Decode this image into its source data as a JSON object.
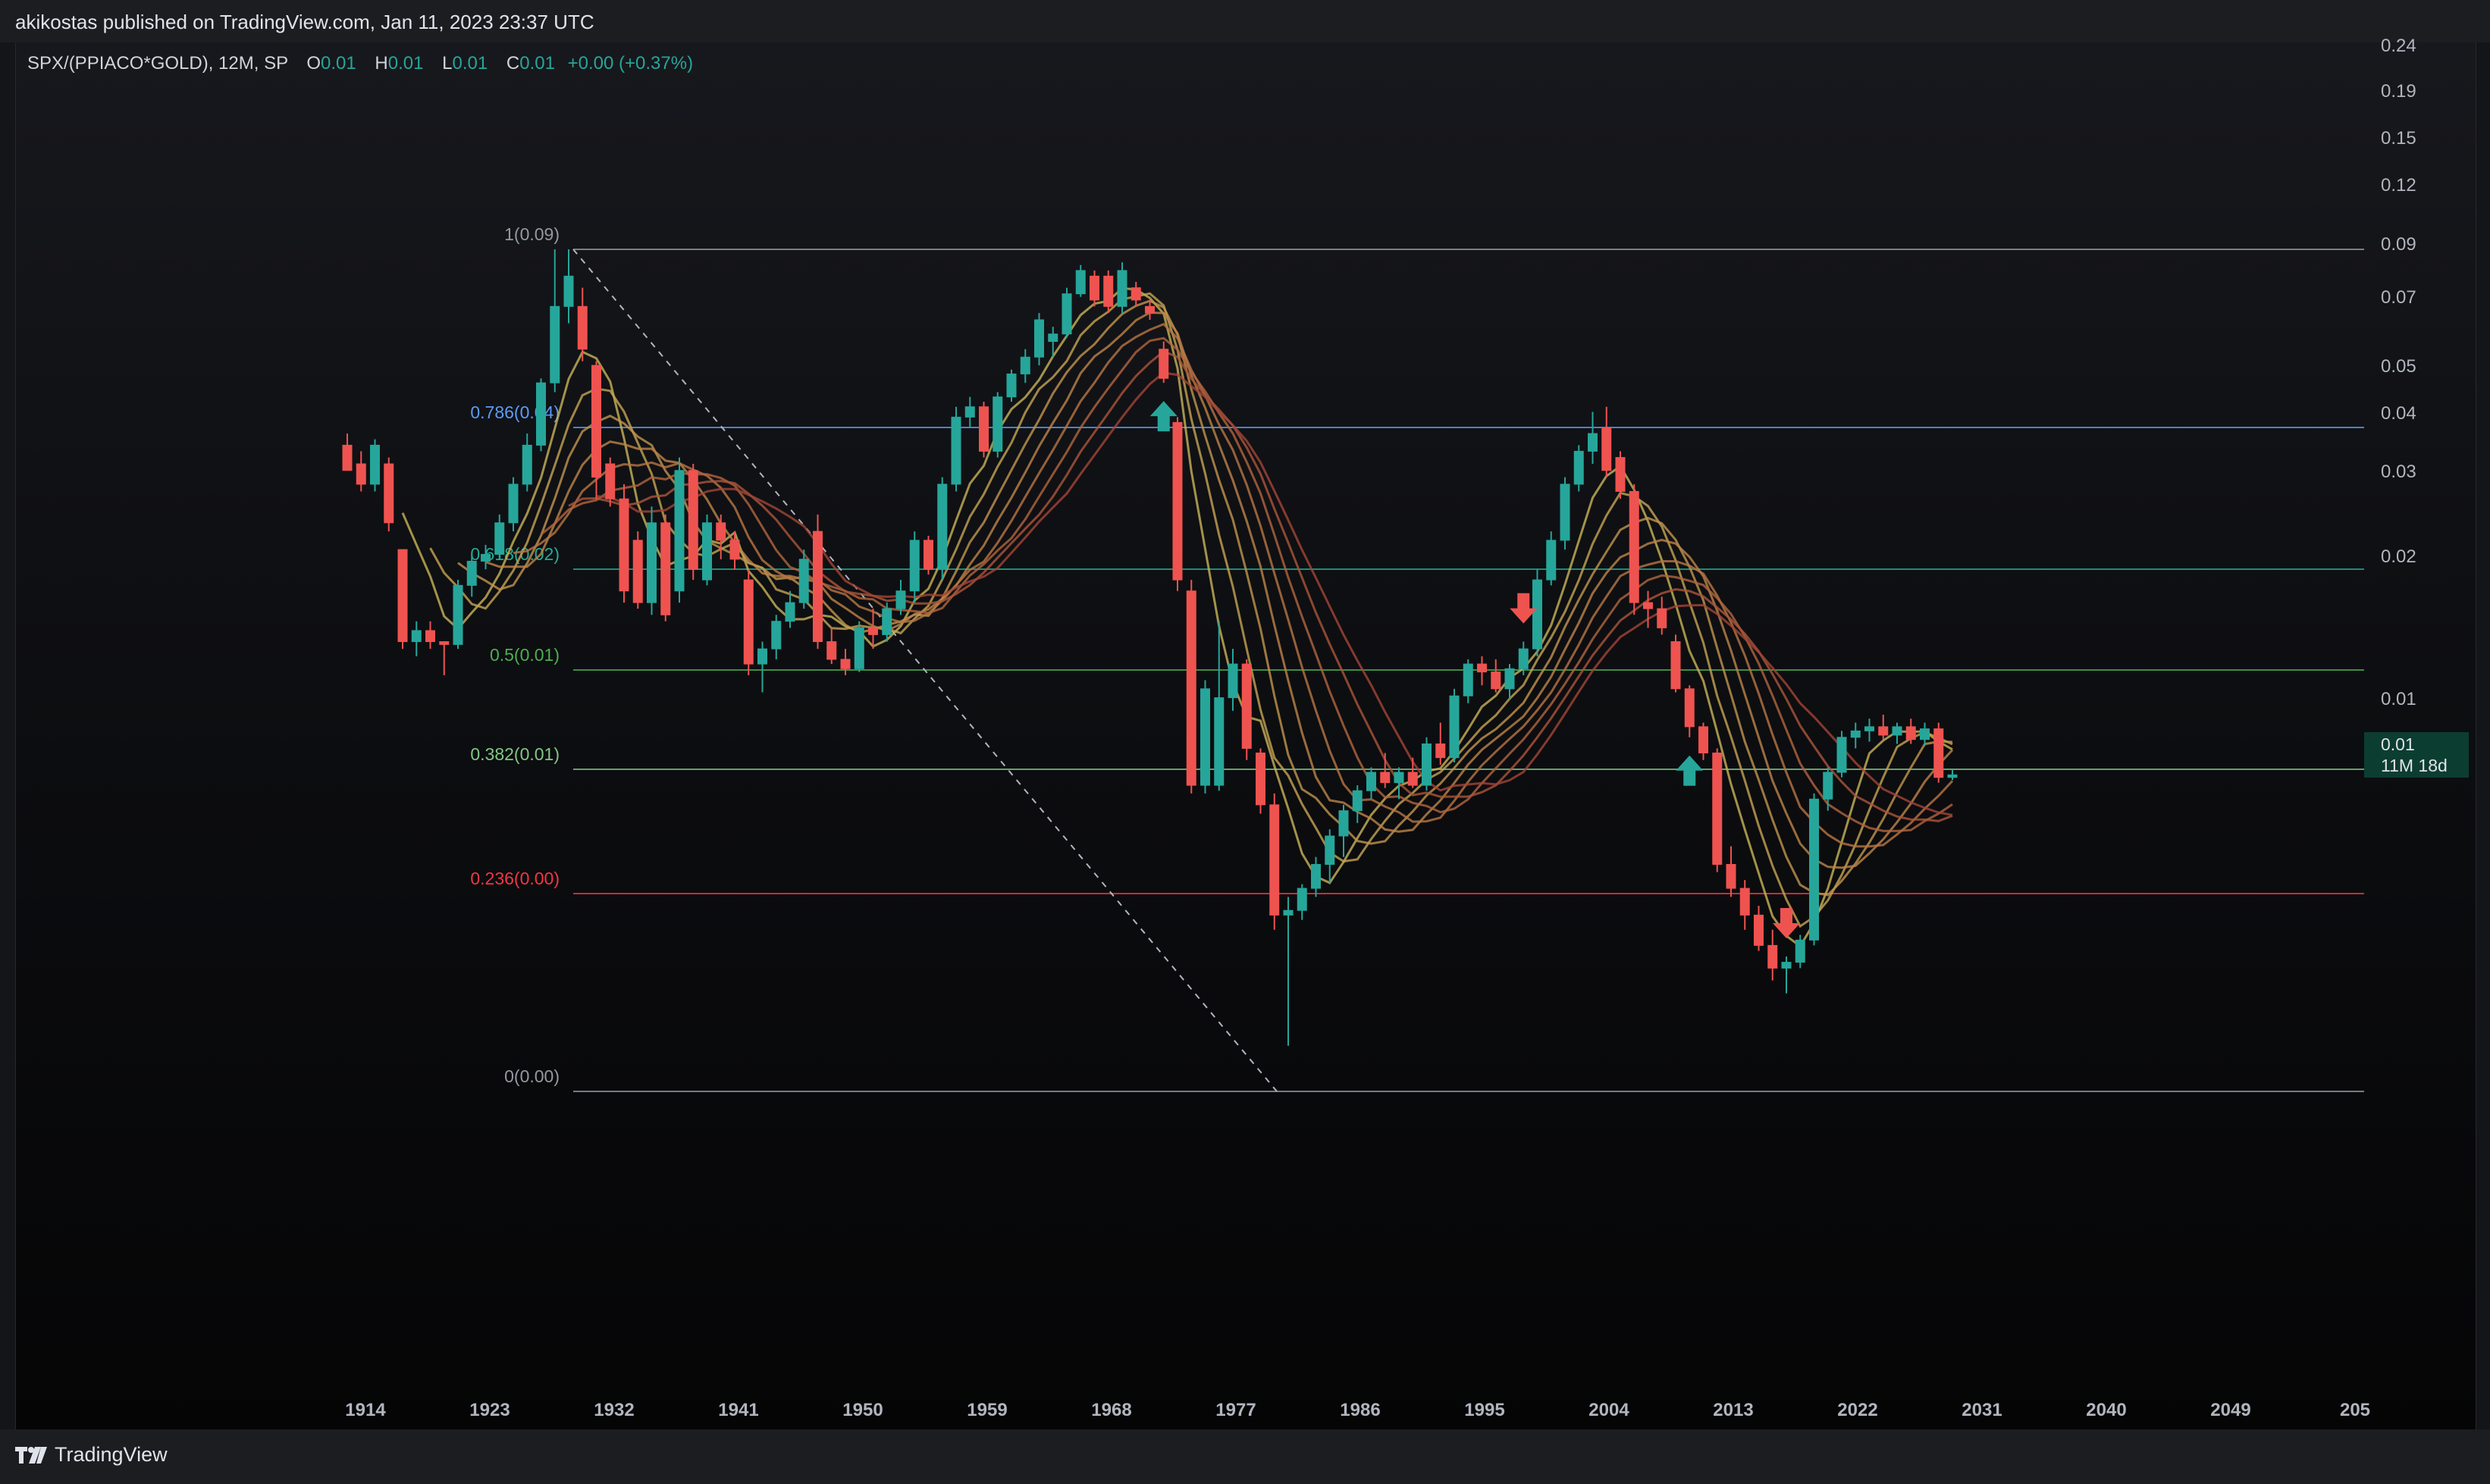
{
  "header": {
    "publisher": "akikostas published on TradingView.com, Jan 11, 2023 23:37 UTC"
  },
  "legend": {
    "symbol": "SPX/(PPIACO*GOLD), 12M, SP",
    "open_label": "O",
    "open": "0.01",
    "high_label": "H",
    "high": "0.01",
    "low_label": "L",
    "low": "0.01",
    "close_label": "C",
    "close": "0.01",
    "change": "+0.00 (+0.37%)"
  },
  "footer": {
    "brand": "TradingView"
  },
  "colors": {
    "up": "#26a69a",
    "down": "#ef5350",
    "fib_1": "#9598a1",
    "fib_0786": "#5b9cf6",
    "fib_0618": "#22ab94",
    "fib_05": "#4caf50",
    "fib_0382": "#81c784",
    "fib_0236": "#f23645",
    "fib_0": "#9598a1",
    "price_tag": "#0c3d31"
  },
  "chart_data": {
    "type": "candlestick",
    "interval": "12M",
    "y_scale": "log",
    "x_ticks": [
      "1914",
      "1923",
      "1932",
      "1941",
      "1950",
      "1959",
      "1968",
      "1977",
      "1986",
      "1995",
      "2004",
      "2013",
      "2022",
      "2031",
      "2040",
      "2049",
      "205"
    ],
    "y_ticks": [
      "0.24",
      "0.19",
      "0.15",
      "0.12",
      "0.09",
      "0.07",
      "0.05",
      "0.04",
      "0.03",
      "0.02",
      "0.01"
    ],
    "current_price": {
      "value": "0.01",
      "countdown": "11M 18d"
    },
    "fib_levels": [
      {
        "label": "1(0.09)",
        "level": 1,
        "value": 0.09
      },
      {
        "label": "0.786(0.04)",
        "level": 0.786,
        "value": 0.04
      },
      {
        "label": "0.618(0.02)",
        "level": 0.618,
        "value": 0.02
      },
      {
        "label": "0.5(0.01)",
        "level": 0.5,
        "value": 0.01
      },
      {
        "label": "0.382(0.01)",
        "level": 0.382,
        "value": 0.01
      },
      {
        "label": "0.236(0.00)",
        "level": 0.236,
        "value": 0.0
      },
      {
        "label": "0(0.00)",
        "level": 0,
        "value": 0.0
      }
    ],
    "trend_line": {
      "from": {
        "year": 1929,
        "value": 0.09
      },
      "to": {
        "year": 1980,
        "value": 0.0027
      }
    },
    "arrows": [
      {
        "year": 1973,
        "direction": "up"
      },
      {
        "year": 1999,
        "direction": "down"
      },
      {
        "year": 2011,
        "direction": "up"
      },
      {
        "year": 2018,
        "direction": "down"
      }
    ],
    "candles": [
      {
        "year": 1914,
        "o": 0.038,
        "h": 0.04,
        "l": 0.034,
        "c": 0.034
      },
      {
        "year": 1915,
        "o": 0.035,
        "h": 0.037,
        "l": 0.031,
        "c": 0.032
      },
      {
        "year": 1916,
        "o": 0.032,
        "h": 0.039,
        "l": 0.031,
        "c": 0.038
      },
      {
        "year": 1917,
        "o": 0.035,
        "h": 0.036,
        "l": 0.026,
        "c": 0.027
      },
      {
        "year": 1918,
        "o": 0.024,
        "h": 0.024,
        "l": 0.0155,
        "c": 0.016
      },
      {
        "year": 1919,
        "o": 0.016,
        "h": 0.0175,
        "l": 0.015,
        "c": 0.0168
      },
      {
        "year": 1920,
        "o": 0.0168,
        "h": 0.0175,
        "l": 0.0155,
        "c": 0.016
      },
      {
        "year": 1921,
        "o": 0.016,
        "h": 0.016,
        "l": 0.0138,
        "c": 0.0158
      },
      {
        "year": 1922,
        "o": 0.0158,
        "h": 0.021,
        "l": 0.0155,
        "c": 0.0205
      },
      {
        "year": 1923,
        "o": 0.0205,
        "h": 0.0235,
        "l": 0.0195,
        "c": 0.0228
      },
      {
        "year": 1924,
        "o": 0.0228,
        "h": 0.0245,
        "l": 0.022,
        "c": 0.0235
      },
      {
        "year": 1925,
        "o": 0.0235,
        "h": 0.028,
        "l": 0.023,
        "c": 0.027
      },
      {
        "year": 1926,
        "o": 0.027,
        "h": 0.033,
        "l": 0.026,
        "c": 0.032
      },
      {
        "year": 1927,
        "o": 0.032,
        "h": 0.04,
        "l": 0.031,
        "c": 0.038
      },
      {
        "year": 1928,
        "o": 0.038,
        "h": 0.051,
        "l": 0.037,
        "c": 0.05
      },
      {
        "year": 1929,
        "o": 0.05,
        "h": 0.09,
        "l": 0.048,
        "c": 0.07
      },
      {
        "year": 1930,
        "o": 0.07,
        "h": 0.09,
        "l": 0.065,
        "c": 0.08
      },
      {
        "year": 1931,
        "o": 0.07,
        "h": 0.076,
        "l": 0.055,
        "c": 0.058
      },
      {
        "year": 1932,
        "o": 0.054,
        "h": 0.055,
        "l": 0.03,
        "c": 0.033
      },
      {
        "year": 1933,
        "o": 0.035,
        "h": 0.036,
        "l": 0.029,
        "c": 0.03
      },
      {
        "year": 1934,
        "o": 0.03,
        "h": 0.032,
        "l": 0.019,
        "c": 0.02
      },
      {
        "year": 1935,
        "o": 0.025,
        "h": 0.026,
        "l": 0.0185,
        "c": 0.019
      },
      {
        "year": 1936,
        "o": 0.019,
        "h": 0.029,
        "l": 0.018,
        "c": 0.027
      },
      {
        "year": 1937,
        "o": 0.027,
        "h": 0.028,
        "l": 0.0175,
        "c": 0.018
      },
      {
        "year": 1938,
        "o": 0.02,
        "h": 0.036,
        "l": 0.019,
        "c": 0.034
      },
      {
        "year": 1939,
        "o": 0.034,
        "h": 0.035,
        "l": 0.021,
        "c": 0.022
      },
      {
        "year": 1940,
        "o": 0.021,
        "h": 0.028,
        "l": 0.0205,
        "c": 0.027
      },
      {
        "year": 1941,
        "o": 0.027,
        "h": 0.028,
        "l": 0.023,
        "c": 0.025
      },
      {
        "year": 1942,
        "o": 0.025,
        "h": 0.026,
        "l": 0.022,
        "c": 0.023
      },
      {
        "year": 1943,
        "o": 0.021,
        "h": 0.022,
        "l": 0.0138,
        "c": 0.0145
      },
      {
        "year": 1944,
        "o": 0.0145,
        "h": 0.016,
        "l": 0.0128,
        "c": 0.0155
      },
      {
        "year": 1945,
        "o": 0.0155,
        "h": 0.018,
        "l": 0.0148,
        "c": 0.0175
      },
      {
        "year": 1946,
        "o": 0.0175,
        "h": 0.02,
        "l": 0.017,
        "c": 0.019
      },
      {
        "year": 1947,
        "o": 0.019,
        "h": 0.024,
        "l": 0.0185,
        "c": 0.023
      },
      {
        "year": 1948,
        "o": 0.026,
        "h": 0.028,
        "l": 0.0155,
        "c": 0.016
      },
      {
        "year": 1949,
        "o": 0.016,
        "h": 0.017,
        "l": 0.0145,
        "c": 0.0148
      },
      {
        "year": 1950,
        "o": 0.0148,
        "h": 0.0155,
        "l": 0.0138,
        "c": 0.0142
      },
      {
        "year": 1951,
        "o": 0.0142,
        "h": 0.0175,
        "l": 0.014,
        "c": 0.017
      },
      {
        "year": 1952,
        "o": 0.017,
        "h": 0.0185,
        "l": 0.0155,
        "c": 0.0165
      },
      {
        "year": 1953,
        "o": 0.0165,
        "h": 0.019,
        "l": 0.016,
        "c": 0.0185
      },
      {
        "year": 1954,
        "o": 0.0185,
        "h": 0.021,
        "l": 0.018,
        "c": 0.02
      },
      {
        "year": 1955,
        "o": 0.02,
        "h": 0.026,
        "l": 0.019,
        "c": 0.025
      },
      {
        "year": 1956,
        "o": 0.025,
        "h": 0.0255,
        "l": 0.0215,
        "c": 0.022
      },
      {
        "year": 1957,
        "o": 0.022,
        "h": 0.033,
        "l": 0.021,
        "c": 0.032
      },
      {
        "year": 1958,
        "o": 0.032,
        "h": 0.045,
        "l": 0.031,
        "c": 0.043
      },
      {
        "year": 1959,
        "o": 0.043,
        "h": 0.047,
        "l": 0.041,
        "c": 0.045
      },
      {
        "year": 1960,
        "o": 0.045,
        "h": 0.046,
        "l": 0.036,
        "c": 0.037
      },
      {
        "year": 1961,
        "o": 0.037,
        "h": 0.048,
        "l": 0.036,
        "c": 0.047
      },
      {
        "year": 1962,
        "o": 0.047,
        "h": 0.053,
        "l": 0.046,
        "c": 0.052
      },
      {
        "year": 1963,
        "o": 0.052,
        "h": 0.058,
        "l": 0.05,
        "c": 0.056
      },
      {
        "year": 1964,
        "o": 0.056,
        "h": 0.068,
        "l": 0.054,
        "c": 0.066
      },
      {
        "year": 1965,
        "o": 0.06,
        "h": 0.064,
        "l": 0.056,
        "c": 0.062
      },
      {
        "year": 1966,
        "o": 0.062,
        "h": 0.076,
        "l": 0.061,
        "c": 0.074
      },
      {
        "year": 1967,
        "o": 0.074,
        "h": 0.084,
        "l": 0.073,
        "c": 0.082
      },
      {
        "year": 1968,
        "o": 0.08,
        "h": 0.082,
        "l": 0.07,
        "c": 0.072
      },
      {
        "year": 1969,
        "o": 0.08,
        "h": 0.082,
        "l": 0.068,
        "c": 0.07
      },
      {
        "year": 1970,
        "o": 0.07,
        "h": 0.085,
        "l": 0.068,
        "c": 0.082
      },
      {
        "year": 1971,
        "o": 0.076,
        "h": 0.078,
        "l": 0.07,
        "c": 0.072
      },
      {
        "year": 1972,
        "o": 0.07,
        "h": 0.072,
        "l": 0.066,
        "c": 0.068
      },
      {
        "year": 1973,
        "o": 0.058,
        "h": 0.06,
        "l": 0.05,
        "c": 0.051
      },
      {
        "year": 1974,
        "o": 0.042,
        "h": 0.043,
        "l": 0.02,
        "c": 0.021
      },
      {
        "year": 1975,
        "o": 0.02,
        "h": 0.021,
        "l": 0.0082,
        "c": 0.0085
      },
      {
        "year": 1976,
        "o": 0.0085,
        "h": 0.0135,
        "l": 0.0082,
        "c": 0.013
      },
      {
        "year": 1977,
        "o": 0.0085,
        "h": 0.0175,
        "l": 0.0083,
        "c": 0.0125
      },
      {
        "year": 1978,
        "o": 0.0125,
        "h": 0.0155,
        "l": 0.0118,
        "c": 0.0145
      },
      {
        "year": 1979,
        "o": 0.0145,
        "h": 0.0148,
        "l": 0.0095,
        "c": 0.01
      },
      {
        "year": 1980,
        "o": 0.0098,
        "h": 0.01,
        "l": 0.0075,
        "c": 0.0078
      },
      {
        "year": 1981,
        "o": 0.0078,
        "h": 0.0082,
        "l": 0.0045,
        "c": 0.0048
      },
      {
        "year": 1982,
        "o": 0.0048,
        "h": 0.0052,
        "l": 0.0027,
        "c": 0.0049
      },
      {
        "year": 1983,
        "o": 0.0049,
        "h": 0.0055,
        "l": 0.0047,
        "c": 0.0054
      },
      {
        "year": 1984,
        "o": 0.0054,
        "h": 0.0062,
        "l": 0.0052,
        "c": 0.006
      },
      {
        "year": 1985,
        "o": 0.006,
        "h": 0.007,
        "l": 0.0055,
        "c": 0.0068
      },
      {
        "year": 1986,
        "o": 0.0068,
        "h": 0.0078,
        "l": 0.0062,
        "c": 0.0076
      },
      {
        "year": 1987,
        "o": 0.0076,
        "h": 0.0085,
        "l": 0.0072,
        "c": 0.0083
      },
      {
        "year": 1988,
        "o": 0.0083,
        "h": 0.0092,
        "l": 0.008,
        "c": 0.009
      },
      {
        "year": 1989,
        "o": 0.009,
        "h": 0.0098,
        "l": 0.0084,
        "c": 0.0086
      },
      {
        "year": 1990,
        "o": 0.0086,
        "h": 0.0092,
        "l": 0.008,
        "c": 0.009
      },
      {
        "year": 1991,
        "o": 0.009,
        "h": 0.0096,
        "l": 0.0084,
        "c": 0.0085
      },
      {
        "year": 1992,
        "o": 0.0085,
        "h": 0.0105,
        "l": 0.0083,
        "c": 0.0102
      },
      {
        "year": 1993,
        "o": 0.0102,
        "h": 0.0112,
        "l": 0.0093,
        "c": 0.0096
      },
      {
        "year": 1994,
        "o": 0.0096,
        "h": 0.013,
        "l": 0.0094,
        "c": 0.0126
      },
      {
        "year": 1995,
        "o": 0.0126,
        "h": 0.0148,
        "l": 0.0122,
        "c": 0.0145
      },
      {
        "year": 1996,
        "o": 0.0145,
        "h": 0.015,
        "l": 0.0132,
        "c": 0.014
      },
      {
        "year": 1997,
        "o": 0.014,
        "h": 0.0148,
        "l": 0.0128,
        "c": 0.013
      },
      {
        "year": 1998,
        "o": 0.013,
        "h": 0.0145,
        "l": 0.0124,
        "c": 0.0142
      },
      {
        "year": 1999,
        "o": 0.0142,
        "h": 0.016,
        "l": 0.0138,
        "c": 0.0155
      },
      {
        "year": 2000,
        "o": 0.0155,
        "h": 0.022,
        "l": 0.015,
        "c": 0.021
      },
      {
        "year": 2001,
        "o": 0.021,
        "h": 0.026,
        "l": 0.0205,
        "c": 0.025
      },
      {
        "year": 2002,
        "o": 0.025,
        "h": 0.033,
        "l": 0.024,
        "c": 0.032
      },
      {
        "year": 2003,
        "o": 0.032,
        "h": 0.038,
        "l": 0.031,
        "c": 0.037
      },
      {
        "year": 2004,
        "o": 0.037,
        "h": 0.044,
        "l": 0.035,
        "c": 0.04
      },
      {
        "year": 2005,
        "o": 0.041,
        "h": 0.045,
        "l": 0.033,
        "c": 0.034
      },
      {
        "year": 2006,
        "o": 0.036,
        "h": 0.037,
        "l": 0.03,
        "c": 0.031
      },
      {
        "year": 2007,
        "o": 0.031,
        "h": 0.032,
        "l": 0.018,
        "c": 0.019
      },
      {
        "year": 2008,
        "o": 0.019,
        "h": 0.02,
        "l": 0.017,
        "c": 0.0185
      },
      {
        "year": 2009,
        "o": 0.0185,
        "h": 0.0195,
        "l": 0.0165,
        "c": 0.017
      },
      {
        "year": 2010,
        "o": 0.016,
        "h": 0.0165,
        "l": 0.0128,
        "c": 0.013
      },
      {
        "year": 2011,
        "o": 0.013,
        "h": 0.0132,
        "l": 0.0105,
        "c": 0.011
      },
      {
        "year": 2012,
        "o": 0.011,
        "h": 0.0112,
        "l": 0.0095,
        "c": 0.0098
      },
      {
        "year": 2013,
        "o": 0.0098,
        "h": 0.01,
        "l": 0.0058,
        "c": 0.006
      },
      {
        "year": 2014,
        "o": 0.006,
        "h": 0.0065,
        "l": 0.0052,
        "c": 0.0054
      },
      {
        "year": 2015,
        "o": 0.0054,
        "h": 0.0056,
        "l": 0.0045,
        "c": 0.0048
      },
      {
        "year": 2016,
        "o": 0.0048,
        "h": 0.005,
        "l": 0.0041,
        "c": 0.0042
      },
      {
        "year": 2017,
        "o": 0.0042,
        "h": 0.0045,
        "l": 0.0036,
        "c": 0.0038
      },
      {
        "year": 2018,
        "o": 0.0038,
        "h": 0.004,
        "l": 0.0034,
        "c": 0.0039
      },
      {
        "year": 2019,
        "o": 0.0039,
        "h": 0.0044,
        "l": 0.0038,
        "c": 0.0043
      },
      {
        "year": 2020,
        "o": 0.0043,
        "h": 0.0082,
        "l": 0.0042,
        "c": 0.008
      },
      {
        "year": 2021,
        "o": 0.008,
        "h": 0.0092,
        "l": 0.0076,
        "c": 0.009
      },
      {
        "year": 2022,
        "o": 0.009,
        "h": 0.0108,
        "l": 0.0088,
        "c": 0.0105
      },
      {
        "year": 2023,
        "o": 0.0105,
        "h": 0.0112,
        "l": 0.01,
        "c": 0.0108
      },
      {
        "year": 2024,
        "o": 0.0108,
        "h": 0.0114,
        "l": 0.0103,
        "c": 0.011
      },
      {
        "year": 2025,
        "o": 0.011,
        "h": 0.0116,
        "l": 0.0104,
        "c": 0.0106
      },
      {
        "year": 2026,
        "o": 0.0106,
        "h": 0.0112,
        "l": 0.0102,
        "c": 0.011
      },
      {
        "year": 2027,
        "o": 0.011,
        "h": 0.0114,
        "l": 0.0102,
        "c": 0.0104
      },
      {
        "year": 2028,
        "o": 0.0104,
        "h": 0.0112,
        "l": 0.0101,
        "c": 0.0109
      },
      {
        "year": 2029,
        "o": 0.0109,
        "h": 0.0112,
        "l": 0.0086,
        "c": 0.0088
      },
      {
        "year": 2030,
        "o": 0.0088,
        "h": 0.0091,
        "l": 0.0087,
        "c": 0.0089
      }
    ]
  }
}
